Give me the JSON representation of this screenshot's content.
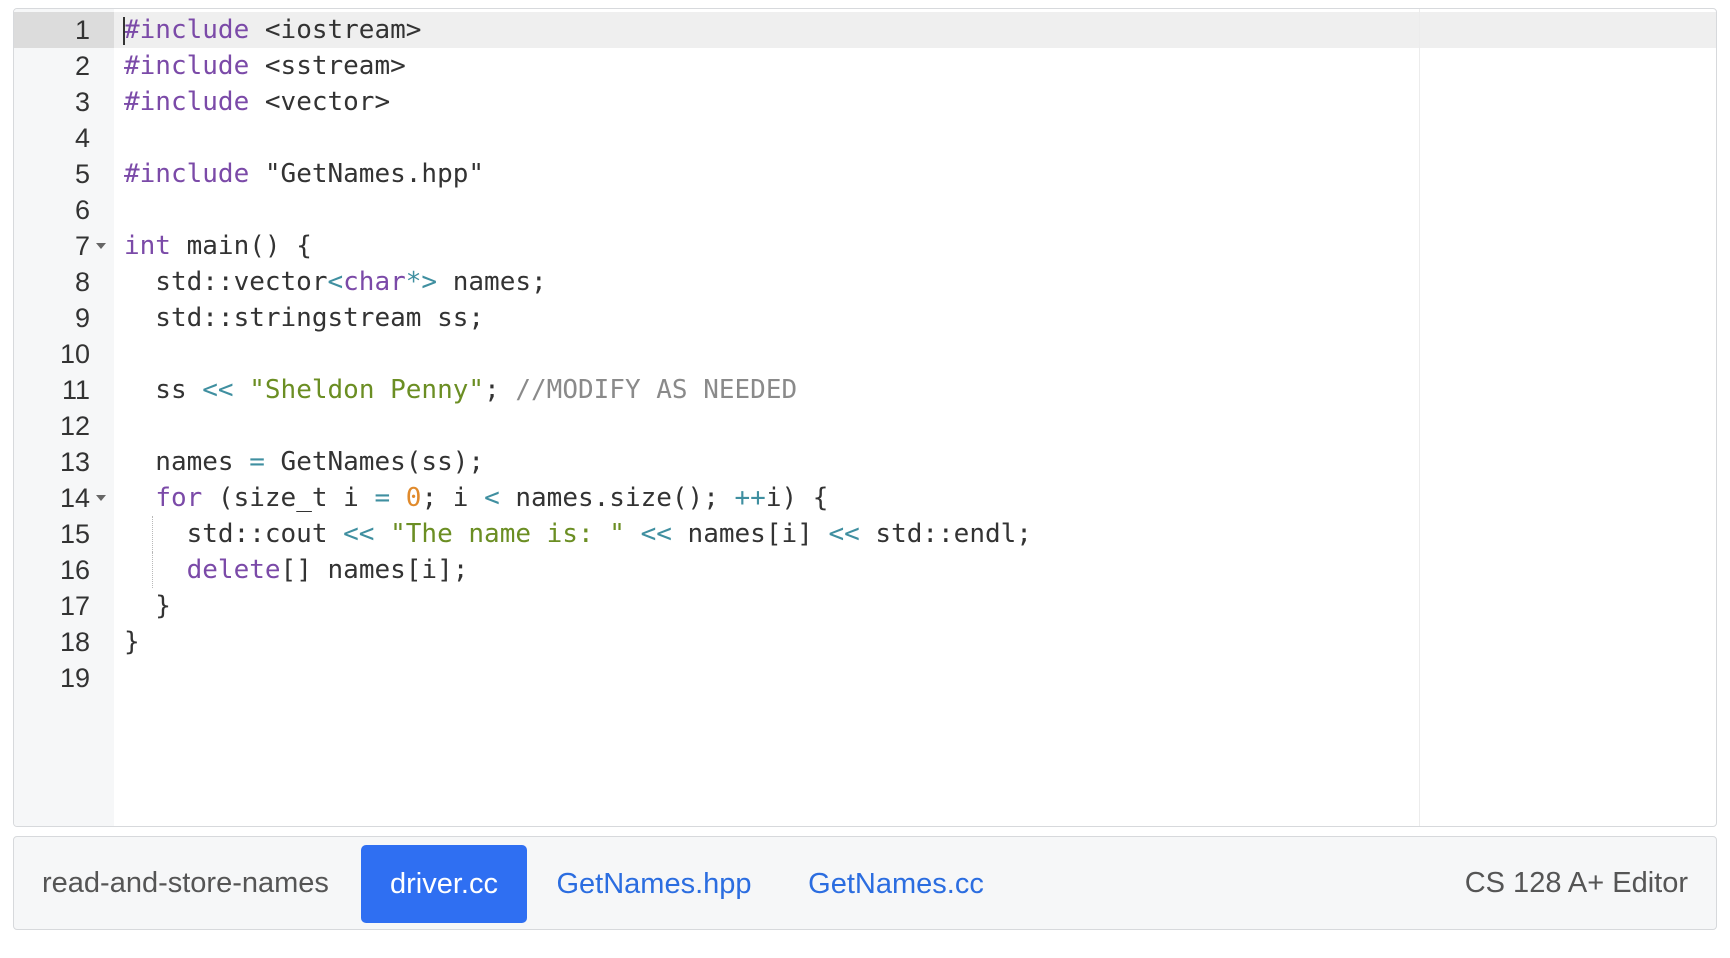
{
  "editor": {
    "lines": [
      {
        "n": "1",
        "tokens": [
          {
            "t": "#include",
            "c": "kw"
          },
          {
            "t": " <iostream>"
          }
        ]
      },
      {
        "n": "2",
        "tokens": [
          {
            "t": "#include",
            "c": "kw"
          },
          {
            "t": " <sstream>"
          }
        ]
      },
      {
        "n": "3",
        "tokens": [
          {
            "t": "#include",
            "c": "kw"
          },
          {
            "t": " <vector>"
          }
        ]
      },
      {
        "n": "4",
        "tokens": []
      },
      {
        "n": "5",
        "tokens": [
          {
            "t": "#include",
            "c": "kw"
          },
          {
            "t": " \"GetNames.hpp\""
          }
        ]
      },
      {
        "n": "6",
        "tokens": []
      },
      {
        "n": "7",
        "fold": true,
        "tokens": [
          {
            "t": "int",
            "c": "kw"
          },
          {
            "t": " main() {"
          }
        ]
      },
      {
        "n": "8",
        "tokens": [
          {
            "t": "  std::vector"
          },
          {
            "t": "<",
            "c": "op"
          },
          {
            "t": "char",
            "c": "kw"
          },
          {
            "t": "*>",
            "c": "op"
          },
          {
            "t": " names;"
          }
        ]
      },
      {
        "n": "9",
        "tokens": [
          {
            "t": "  std::stringstream ss;"
          }
        ]
      },
      {
        "n": "10",
        "tokens": []
      },
      {
        "n": "11",
        "tokens": [
          {
            "t": "  ss "
          },
          {
            "t": "<<",
            "c": "op"
          },
          {
            "t": " "
          },
          {
            "t": "\"Sheldon Penny\"",
            "c": "str"
          },
          {
            "t": "; "
          },
          {
            "t": "//MODIFY AS NEEDED",
            "c": "cmt"
          }
        ]
      },
      {
        "n": "12",
        "tokens": []
      },
      {
        "n": "13",
        "tokens": [
          {
            "t": "  names "
          },
          {
            "t": "=",
            "c": "op"
          },
          {
            "t": " GetNames(ss);"
          }
        ]
      },
      {
        "n": "14",
        "fold": true,
        "tokens": [
          {
            "t": "  "
          },
          {
            "t": "for",
            "c": "kw"
          },
          {
            "t": " (size_t i "
          },
          {
            "t": "=",
            "c": "op"
          },
          {
            "t": " "
          },
          {
            "t": "0",
            "c": "num"
          },
          {
            "t": "; i "
          },
          {
            "t": "<",
            "c": "op"
          },
          {
            "t": " names.size(); "
          },
          {
            "t": "++",
            "c": "op"
          },
          {
            "t": "i) {"
          }
        ]
      },
      {
        "n": "15",
        "guide": true,
        "tokens": [
          {
            "t": "    std::cout "
          },
          {
            "t": "<<",
            "c": "op"
          },
          {
            "t": " "
          },
          {
            "t": "\"The name is: \"",
            "c": "str"
          },
          {
            "t": " "
          },
          {
            "t": "<<",
            "c": "op"
          },
          {
            "t": " names[i] "
          },
          {
            "t": "<<",
            "c": "op"
          },
          {
            "t": " std::endl;"
          }
        ]
      },
      {
        "n": "16",
        "guide": true,
        "tokens": [
          {
            "t": "    "
          },
          {
            "t": "delete",
            "c": "kw"
          },
          {
            "t": "[] names[i];"
          }
        ]
      },
      {
        "n": "17",
        "tokens": [
          {
            "t": "  }"
          }
        ]
      },
      {
        "n": "18",
        "tokens": [
          {
            "t": "}"
          }
        ]
      },
      {
        "n": "19",
        "tokens": []
      }
    ]
  },
  "footer": {
    "project_name": "read-and-store-names",
    "tabs": [
      "driver.cc",
      "GetNames.hpp",
      "GetNames.cc"
    ],
    "active_tab": "driver.cc",
    "brand": "CS 128 A+ Editor"
  },
  "colors": {
    "keyword": "#7b4aa8",
    "string": "#6b8e23",
    "comment": "#8a8a8a",
    "number": "#e08a2c",
    "operator": "#3f8fa0",
    "active_tab_bg": "#2f6ff2",
    "tab_link": "#2b6de0"
  }
}
